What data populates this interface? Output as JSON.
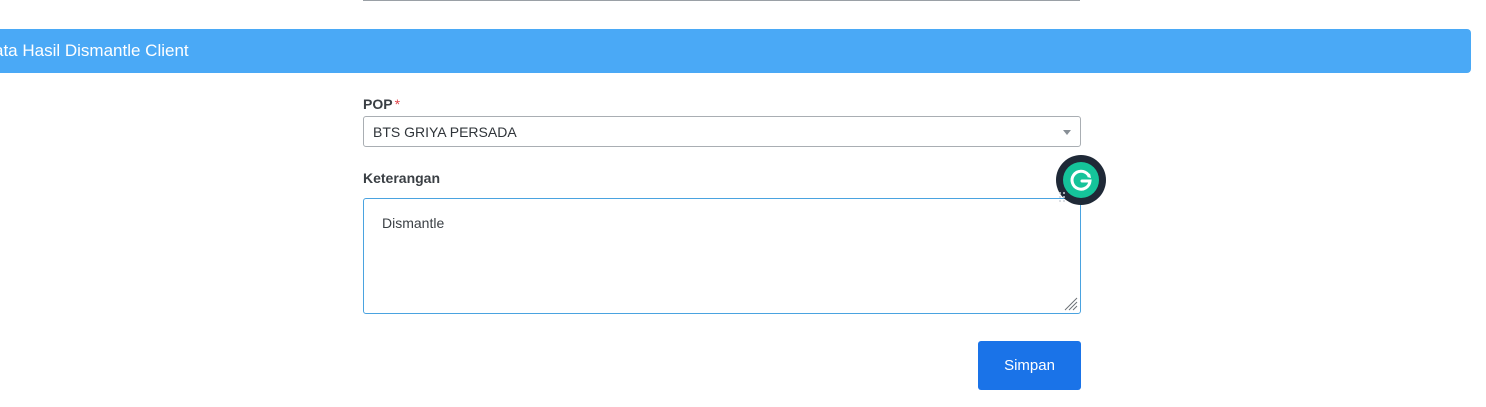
{
  "section": {
    "title": "ata Hasil Dismantle Client"
  },
  "form": {
    "pop": {
      "label": "POP",
      "required_mark": "*",
      "selected_value": "BTS GRIYA PERSADA"
    },
    "keterangan": {
      "label": "Keterangan",
      "value": "Dismantle"
    },
    "submit_label": "Simpan"
  },
  "icons": {
    "dropdown": "chevron-down-icon",
    "resize": "resize-grip-icon",
    "grammarly": "grammarly-g-icon"
  },
  "colors": {
    "header_bg": "#4aa9f6",
    "button_bg": "#1a73e8",
    "required": "#e0454b",
    "grammarly_green": "#15c39a"
  }
}
